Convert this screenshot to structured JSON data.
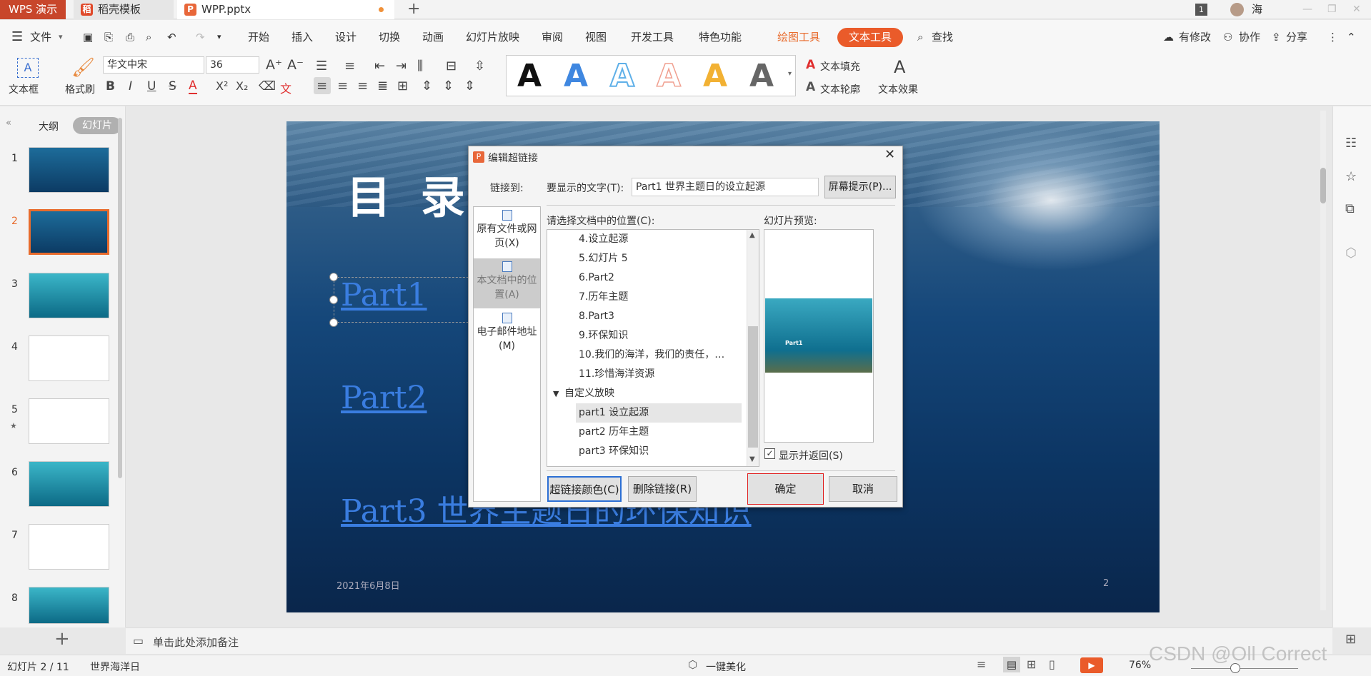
{
  "titlebar": {
    "app_name": "WPS 演示",
    "tabs": [
      {
        "label": "稻壳模板"
      },
      {
        "label": "WPP.pptx"
      }
    ],
    "window_count": "1",
    "user": "海"
  },
  "menu": {
    "file": "文件",
    "items": [
      "开始",
      "插入",
      "设计",
      "切换",
      "动画",
      "幻灯片放映",
      "审阅",
      "视图",
      "开发工具",
      "特色功能"
    ],
    "drawing_tools": "绘图工具",
    "text_tools": "文本工具",
    "search": "查找",
    "changes": "有修改",
    "collab": "协作",
    "share": "分享"
  },
  "ribbon": {
    "textbox": "文本框",
    "format_painter": "格式刷",
    "font_name": "华文中宋",
    "font_size": "36",
    "text_fill": "文本填充",
    "text_outline": "文本轮廓",
    "text_effect": "文本效果",
    "style_colors": [
      "#111111",
      "#3f87e0",
      "#5fb0e8",
      "#f0a090",
      "#f2b133",
      "#666666"
    ]
  },
  "left_panel": {
    "outline_tab": "大纲",
    "slides_tab": "幻灯片",
    "slide_numbers": [
      "1",
      "2",
      "3",
      "4",
      "5",
      "6",
      "7",
      "8"
    ]
  },
  "slide": {
    "title": "目 录",
    "links": [
      "Part1",
      "Part2",
      "Part3  世界主题日的环保知识"
    ],
    "date": "2021年6月8日",
    "page": "2"
  },
  "dialog": {
    "title": "编辑超链接",
    "link_to": "链接到:",
    "display_text_label": "要显示的文字(T):",
    "display_text_value": "Part1   世界主题日的设立起源",
    "screen_tip": "屏幕提示(P)...",
    "nav": [
      {
        "label": "原有文件或网页(X)"
      },
      {
        "label": "本文档中的位置(A)"
      },
      {
        "label": "电子邮件地址(M)"
      }
    ],
    "location_label": "请选择文档中的位置(C):",
    "preview_label": "幻灯片预览:",
    "tree_items": [
      "4.设立起源",
      "5.幻灯片 5",
      "6.Part2",
      "7.历年主题",
      "8.Part3",
      "9.环保知识",
      "10.我们的海洋，我们的责任，…",
      "11.珍惜海洋资源"
    ],
    "custom_show": "自定义放映",
    "custom_items": [
      "part1 设立起源",
      "part2 历年主题",
      "part3 环保知识"
    ],
    "preview_thumb_text": "Part1",
    "show_return": "显示并返回(S)",
    "link_color": "超链接颜色(C)",
    "remove_link": "删除链接(R)",
    "ok": "确定",
    "cancel": "取消"
  },
  "notes": {
    "placeholder": "单击此处添加备注"
  },
  "status": {
    "slide_info": "幻灯片 2 / 11",
    "theme": "世界海洋日",
    "beautify": "一键美化",
    "zoom": "76%",
    "watermark": "CSDN @Oll Correct"
  }
}
